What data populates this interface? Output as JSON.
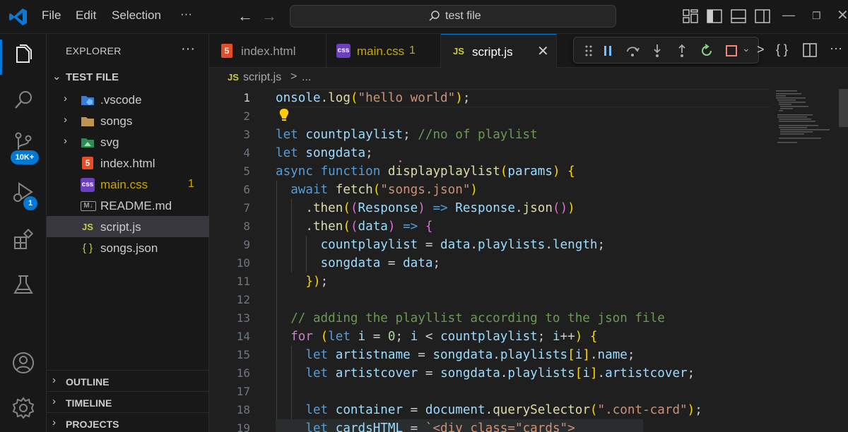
{
  "window": {
    "menu": [
      "File",
      "Edit",
      "Selection",
      "···"
    ],
    "search_text": "test file"
  },
  "activity": {
    "scm_badge": "10K+",
    "debug_badge": "1",
    "icons": [
      "files-icon",
      "search-icon",
      "source-control-icon",
      "run-debug-icon",
      "extensions-icon",
      "testing-icon",
      "account-icon",
      "settings-gear-icon"
    ]
  },
  "explorer": {
    "title": "EXPLORER",
    "more": "···",
    "folder": "TEST FILE",
    "items": [
      {
        "name": ".vscode",
        "kind": "folder",
        "icon": "vscode-folder-icon"
      },
      {
        "name": "songs",
        "kind": "folder",
        "icon": "folder-icon"
      },
      {
        "name": "svg",
        "kind": "folder",
        "icon": "svg-folder-icon"
      },
      {
        "name": "index.html",
        "kind": "file",
        "icon": "html5-icon"
      },
      {
        "name": "main.css",
        "kind": "file",
        "icon": "css-icon",
        "badge": "1"
      },
      {
        "name": "README.md",
        "kind": "file",
        "icon": "markdown-icon"
      },
      {
        "name": "script.js",
        "kind": "file",
        "icon": "js-icon"
      },
      {
        "name": "songs.json",
        "kind": "file",
        "icon": "json-icon"
      }
    ],
    "panels": [
      "OUTLINE",
      "TIMELINE",
      "PROJECTS"
    ]
  },
  "tabs": [
    {
      "label": "index.html",
      "icon": "html5-icon"
    },
    {
      "label": "main.css",
      "icon": "css-icon",
      "badge": "1"
    },
    {
      "label": "script.js",
      "icon": "js-icon"
    }
  ],
  "icon_text": {
    "js": "JS",
    "css": "css",
    "md": "M↓",
    "json": "{ }",
    "html": "5"
  },
  "breadcrumb": {
    "file": "script.js",
    "sep": ">",
    "more": "..."
  },
  "editor_actions": [
    ">",
    "{ }"
  ],
  "editor": {
    "line_numbers": [
      "1",
      "2",
      "3",
      "4",
      "5",
      "6",
      "7",
      "8",
      "9",
      "10",
      "11",
      "12",
      "13",
      "14",
      "15",
      "16",
      "17",
      "18",
      "19"
    ],
    "lines": [
      "onsole.log(\"hello world\");",
      "",
      "let countplaylist; //no of playlist",
      "let songdata;",
      "async function displayplaylist(params) {",
      "  await fetch(\"songs.json\")",
      "    .then((Response) => Response.json())",
      "    .then((data) => {",
      "      countplaylist = data.playlists.length;",
      "      songdata = data;",
      "    });",
      "",
      "  // adding the playllist according to the json file",
      "  for (let i = 0; i < countplaylist; i++) {",
      "    let artistname = songdata.playlists[i].name;",
      "    let artistcover = songdata.playlists[i].artistcover;",
      "",
      "    let container = document.querySelector(\".cont-card\");",
      "    let cardsHTML = `<div class=\"cards\">"
    ]
  },
  "colors": {
    "accent": "#0078d4",
    "js_yellow": "#cbcb41",
    "css_purple": "#6c3fbf",
    "html_orange": "#e44d26",
    "warning": "#cca700"
  }
}
